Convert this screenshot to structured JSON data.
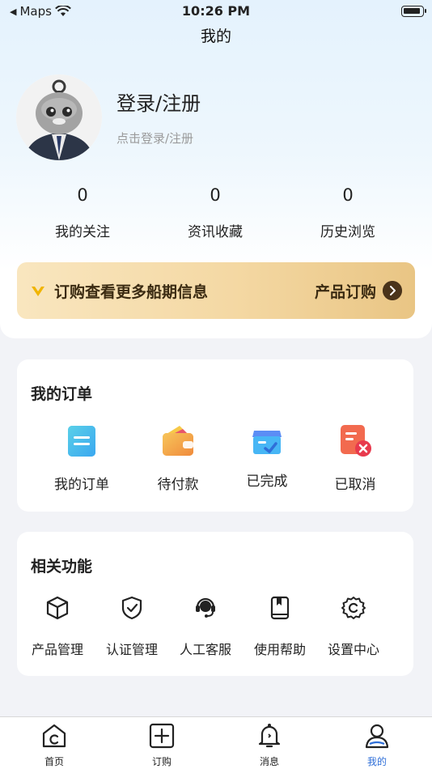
{
  "status_bar": {
    "back_app": "Maps",
    "time": "10:26 PM"
  },
  "nav": {
    "title": "我的"
  },
  "profile": {
    "login_title": "登录/注册",
    "login_subtitle": "点击登录/注册"
  },
  "stats": [
    {
      "value": "0",
      "label": "我的关注"
    },
    {
      "value": "0",
      "label": "资讯收藏"
    },
    {
      "value": "0",
      "label": "历史浏览"
    }
  ],
  "vip_banner": {
    "text": "订购查看更多船期信息",
    "action": "产品订购"
  },
  "orders": {
    "title": "我的订单",
    "items": [
      {
        "label": "我的订单",
        "icon": "order-list-icon"
      },
      {
        "label": "待付款",
        "icon": "wallet-icon"
      },
      {
        "label": "已完成",
        "icon": "completed-box-icon"
      },
      {
        "label": "已取消",
        "icon": "cancelled-doc-icon"
      }
    ]
  },
  "functions": {
    "title": "相关功能",
    "items": [
      {
        "label": "产品管理",
        "icon": "cube-icon"
      },
      {
        "label": "认证管理",
        "icon": "shield-check-icon"
      },
      {
        "label": "人工客服",
        "icon": "headset-icon"
      },
      {
        "label": "使用帮助",
        "icon": "book-icon"
      },
      {
        "label": "设置中心",
        "icon": "gear-icon"
      }
    ]
  },
  "tabbar": {
    "items": [
      {
        "label": "首页",
        "icon": "home-icon"
      },
      {
        "label": "订购",
        "icon": "plus-square-icon"
      },
      {
        "label": "消息",
        "icon": "bell-icon"
      },
      {
        "label": "我的",
        "icon": "user-icon",
        "active": true
      }
    ],
    "active_color": "#2f6fd8"
  },
  "colors": {
    "accent": "#2f6fd8",
    "vip_gold": "#f4d8a3",
    "vip_text": "#3b2b12"
  }
}
